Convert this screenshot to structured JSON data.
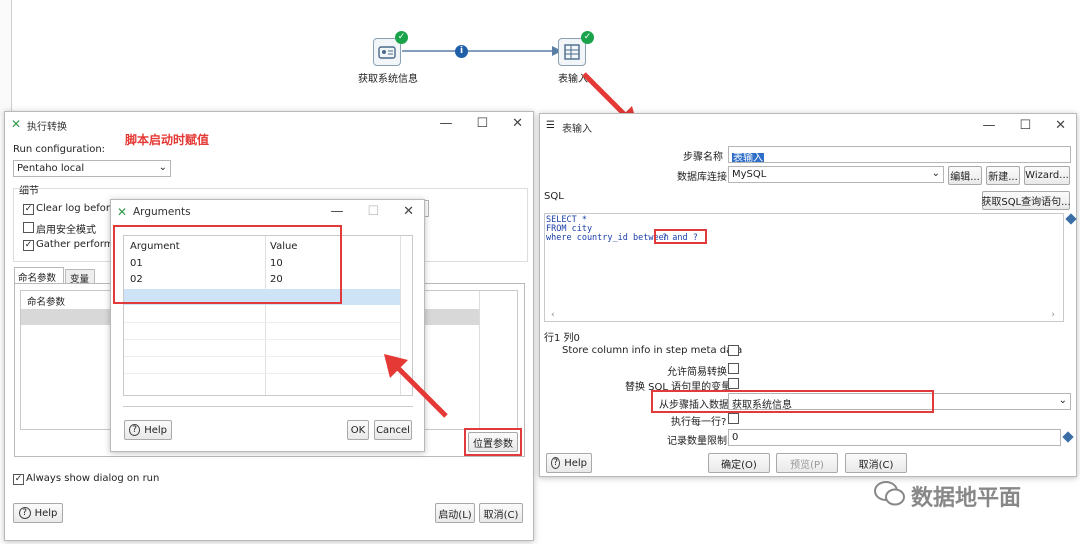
{
  "canvas": {
    "node1_label": "获取系统信息",
    "node2_label": "表输入",
    "hop_info": "i"
  },
  "exec": {
    "title": "执行转换",
    "annotation": "脚本启动时赋值",
    "run_config_label": "Run configuration:",
    "run_config_value": "Pentaho local",
    "details_label": "细节",
    "clear_log": "Clear log before",
    "safe_mode": "启用安全模式",
    "gather": "Gather performa",
    "tab_named": "命名参数",
    "tab_vars": "变量",
    "col_named": "命名参数",
    "pos_params": "位置参数",
    "always_show": "Always show dialog on run",
    "help": "Help",
    "start": "启动(L)",
    "cancel": "取消(C)"
  },
  "args": {
    "title": "Arguments",
    "col_arg": "Argument",
    "col_value": "Value",
    "rows": [
      {
        "a": "01",
        "v": "10"
      },
      {
        "a": "02",
        "v": "20"
      }
    ],
    "help": "Help",
    "ok": "OK",
    "cancel": "Cancel"
  },
  "table": {
    "title": "表输入",
    "step_name_label": "步骤名称",
    "step_name_value": "表输入",
    "db_label": "数据库连接",
    "db_value": "MySQL",
    "edit": "编辑...",
    "new": "新建...",
    "wizard": "Wizard...",
    "sql_label": "SQL",
    "get_sql": "获取SQL查询语句...",
    "sql_line1": "SELECT *",
    "sql_line2": "FROM city",
    "sql_line3a": "where country_id between",
    "sql_line3b": "? and ?",
    "position": "行1 列0",
    "store_col": "Store column info in step meta data",
    "lazy": "允许简易转换",
    "replace_vars": "替换 SQL 语句里的变量",
    "insert_from": "从步骤插入数据",
    "insert_value": "获取系统信息",
    "exec_each": "执行每一行?",
    "limit_label": "记录数量限制",
    "limit_value": "0",
    "help": "Help",
    "ok": "确定(O)",
    "preview": "预览(P)",
    "cancel": "取消(C)"
  },
  "watermark": "数据地平面"
}
